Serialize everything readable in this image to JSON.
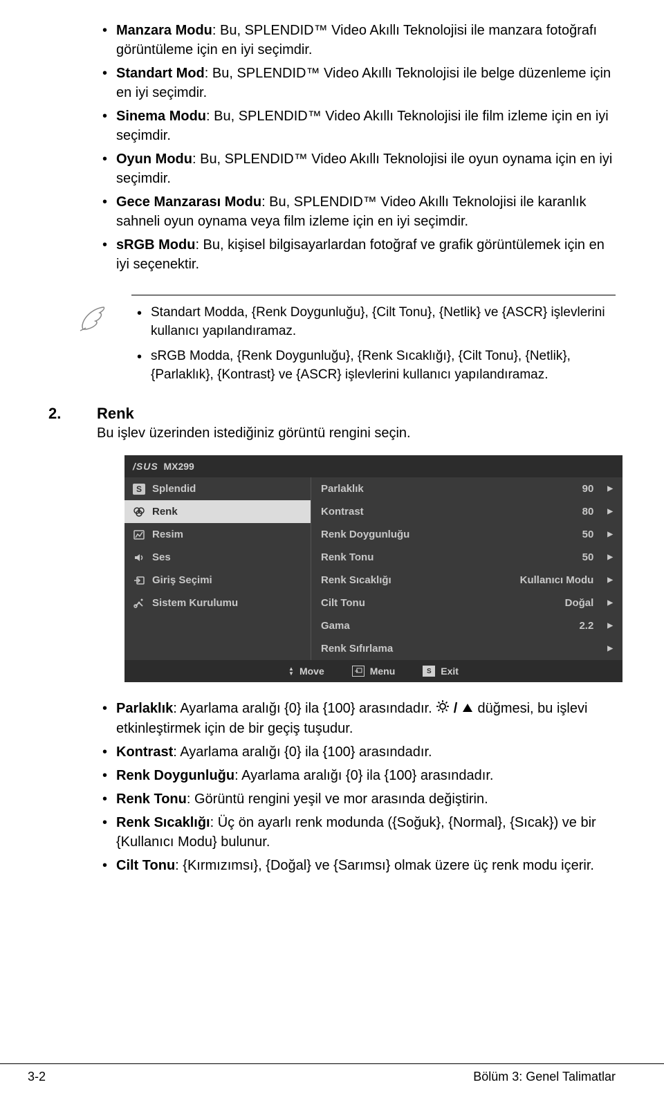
{
  "modes": [
    {
      "title": "Manzara Modu",
      "desc": ": Bu, SPLENDID™ Video Akıllı Teknolojisi ile manzara fotoğrafı görüntüleme için en iyi seçimdir."
    },
    {
      "title": "Standart Mod",
      "desc": ": Bu, SPLENDID™ Video Akıllı Teknolojisi ile belge düzenleme için en iyi seçimdir."
    },
    {
      "title": "Sinema Modu",
      "desc": ": Bu, SPLENDID™ Video Akıllı Teknolojisi ile film izleme için en iyi seçimdir."
    },
    {
      "title": "Oyun Modu",
      "desc": ": Bu, SPLENDID™ Video Akıllı Teknolojisi ile oyun oynama için en iyi seçimdir."
    },
    {
      "title": "Gece Manzarası Modu",
      "desc": ": Bu, SPLENDID™ Video Akıllı Teknolojisi ile karanlık sahneli oyun oynama veya film izleme için en iyi seçimdir."
    },
    {
      "title": "sRGB Modu",
      "desc": ": Bu, kişisel bilgisayarlardan fotoğraf ve grafik görüntülemek için en iyi seçenektir."
    }
  ],
  "notes": [
    "Standart Modda, {Renk Doygunluğu}, {Cilt Tonu}, {Netlik} ve {ASCR} işlevlerini kullanıcı yapılandıramaz.",
    "sRGB Modda, {Renk Doygunluğu}, {Renk Sıcaklığı}, {Cilt Tonu}, {Netlik}, {Parlaklık}, {Kontrast} ve {ASCR} işlevlerini kullanıcı yapılandıramaz."
  ],
  "section": {
    "num": "2.",
    "title": "Renk",
    "desc": "Bu işlev üzerinden istediğiniz görüntü rengini seçin."
  },
  "osd": {
    "model": "MX299",
    "left": [
      {
        "label": "Splendid"
      },
      {
        "label": "Renk"
      },
      {
        "label": "Resim"
      },
      {
        "label": "Ses"
      },
      {
        "label": "Giriş Seçimi"
      },
      {
        "label": "Sistem Kurulumu"
      }
    ],
    "right": [
      {
        "label": "Parlaklık",
        "value": "90"
      },
      {
        "label": "Kontrast",
        "value": "80"
      },
      {
        "label": "Renk Doygunluğu",
        "value": "50"
      },
      {
        "label": "Renk Tonu",
        "value": "50"
      },
      {
        "label": "Renk Sıcaklığı",
        "value": "Kullanıcı Modu"
      },
      {
        "label": "Cilt Tonu",
        "value": "Doğal"
      },
      {
        "label": "Gama",
        "value": "2.2"
      },
      {
        "label": "Renk Sıfırlama",
        "value": ""
      }
    ],
    "footer": {
      "move": "Move",
      "menu": "Menu",
      "exit": "Exit"
    }
  },
  "details": [
    {
      "title": "Parlaklık",
      "desc": ": Ayarlama aralığı {0} ila {100} arasındadır.",
      "tail": " düğmesi, bu işlevi etkinleştirmek için de bir geçiş tuşudur.",
      "icons": true
    },
    {
      "title": "Kontrast",
      "desc": ": Ayarlama aralığı {0} ila {100} arasındadır."
    },
    {
      "title": "Renk Doygunluğu",
      "desc": ": Ayarlama aralığı {0} ila {100} arasındadır."
    },
    {
      "title": "Renk Tonu",
      "desc": ": Görüntü rengini yeşil ve mor arasında değiştirin."
    },
    {
      "title": "Renk Sıcaklığı",
      "desc": ": Üç ön ayarlı renk modunda ({Soğuk}, {Normal}, {Sıcak}) ve bir {Kullanıcı Modu} bulunur."
    },
    {
      "title": "Cilt Tonu",
      "desc": ": {Kırmızımsı}, {Doğal} ve {Sarımsı} olmak üzere üç renk modu içerir."
    }
  ],
  "footer": {
    "left": "3-2",
    "right": "Bölüm 3: Genel Talimatlar"
  }
}
